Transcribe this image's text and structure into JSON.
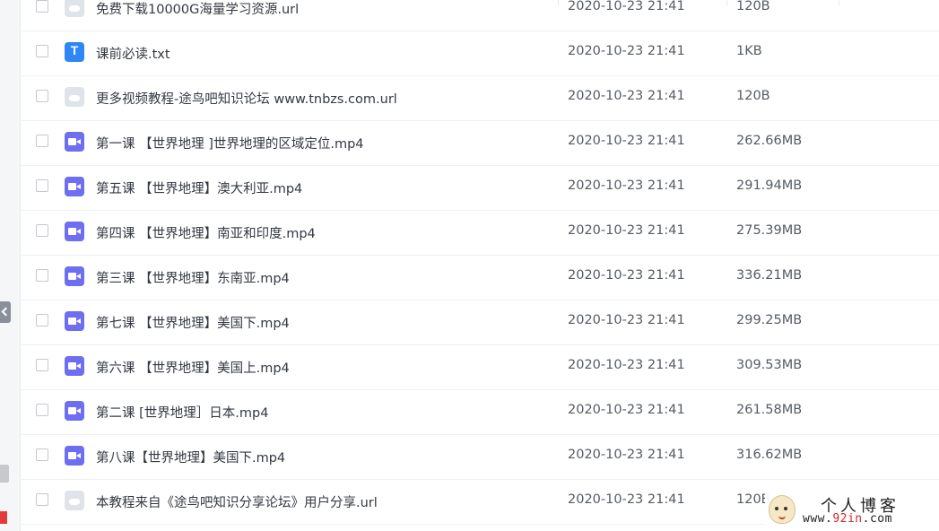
{
  "files": [
    {
      "icon": "url-file-icon",
      "type": "url",
      "name": "免费下载10000G海量学习资源.url",
      "date": "2020-10-23 21:41",
      "size": "120B"
    },
    {
      "icon": "text-file-icon",
      "type": "txt",
      "name": "课前必读.txt",
      "date": "2020-10-23 21:41",
      "size": "1KB"
    },
    {
      "icon": "url-file-icon",
      "type": "url",
      "name": "更多视频教程-途鸟吧知识论坛 www.tnbzs.com.url",
      "date": "2020-10-23 21:41",
      "size": "120B"
    },
    {
      "icon": "video-file-icon",
      "type": "video",
      "name": "第一课 【世界地理 ]世界地理的区域定位.mp4",
      "date": "2020-10-23 21:41",
      "size": "262.66MB"
    },
    {
      "icon": "video-file-icon",
      "type": "video",
      "name": "第五课 【世界地理】澳大利亚.mp4",
      "date": "2020-10-23 21:41",
      "size": "291.94MB"
    },
    {
      "icon": "video-file-icon",
      "type": "video",
      "name": "第四课 【世界地理】南亚和印度.mp4",
      "date": "2020-10-23 21:41",
      "size": "275.39MB"
    },
    {
      "icon": "video-file-icon",
      "type": "video",
      "name": "第三课 【世界地理】东南亚.mp4",
      "date": "2020-10-23 21:41",
      "size": "336.21MB"
    },
    {
      "icon": "video-file-icon",
      "type": "video",
      "name": "第七课 【世界地理】美国下.mp4",
      "date": "2020-10-23 21:41",
      "size": "299.25MB"
    },
    {
      "icon": "video-file-icon",
      "type": "video",
      "name": "第六课 【世界地理】美国上.mp4",
      "date": "2020-10-23 21:41",
      "size": "309.53MB"
    },
    {
      "icon": "video-file-icon",
      "type": "video",
      "name": "第二课 [世界地理］日本.mp4",
      "date": "2020-10-23 21:41",
      "size": "261.58MB"
    },
    {
      "icon": "video-file-icon",
      "type": "video",
      "name": "第八课【世界地理】美国下.mp4",
      "date": "2020-10-23 21:41",
      "size": "316.62MB"
    },
    {
      "icon": "url-file-icon",
      "type": "url",
      "name": "本教程来自《途鸟吧知识分享论坛》用户分享.url",
      "date": "2020-10-23 21:41",
      "size": "120B"
    }
  ],
  "watermark": {
    "title": "个人博客",
    "url_prefix": "www.",
    "url_highlight": "92in",
    "url_suffix": ".com"
  }
}
